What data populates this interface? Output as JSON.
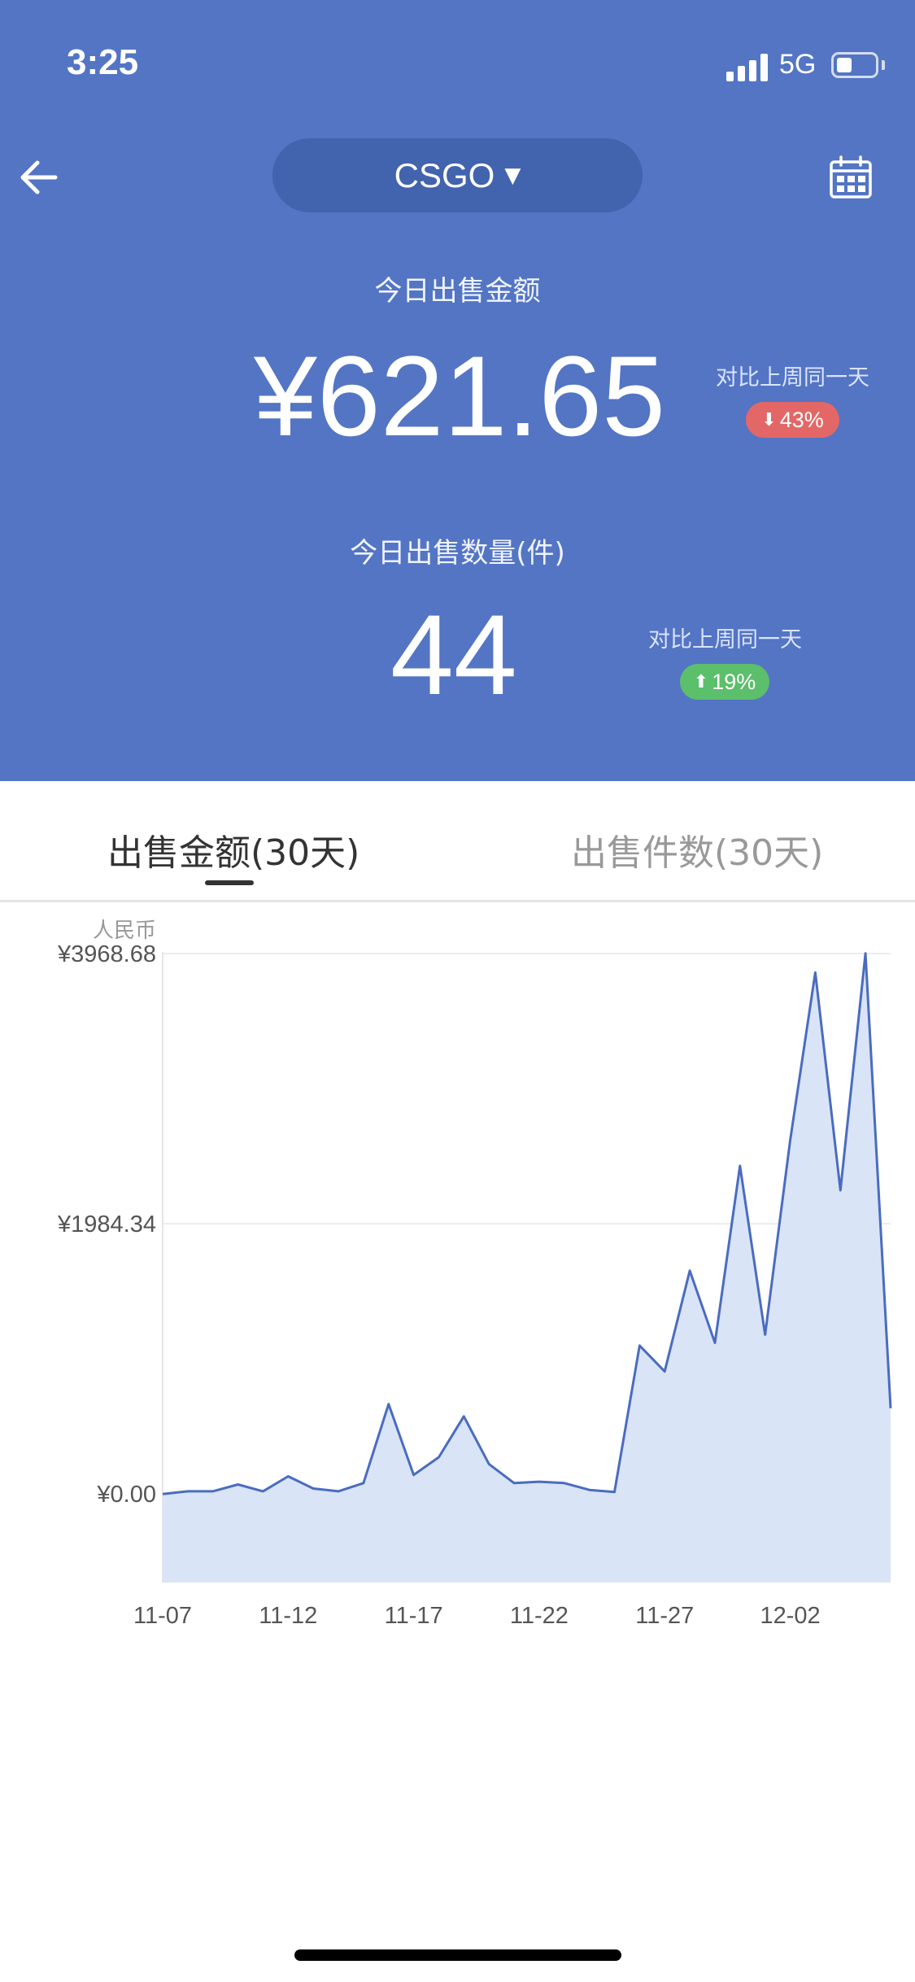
{
  "status_bar": {
    "time": "3:25",
    "network": "5G",
    "battery_level": 0.35
  },
  "nav": {
    "back_icon": "arrow-left-icon",
    "game_selector": "CSGO",
    "game_selector_icon": "caret-down-icon",
    "calendar_icon": "calendar-icon"
  },
  "summary": {
    "amount_label": "今日出售金额",
    "amount_value": "¥621.65",
    "amount_compare_label": "对比上周同一天",
    "amount_change": "43%",
    "amount_change_direction": "down",
    "count_label": "今日出售数量(件)",
    "count_value": "44",
    "count_compare_label": "对比上周同一天",
    "count_change": "19%",
    "count_change_direction": "up"
  },
  "tabs": [
    {
      "label": "出售金额(30天)",
      "active": true
    },
    {
      "label": "出售件数(30天)",
      "active": false
    }
  ],
  "colors": {
    "header_bg": "#5375c4",
    "selector_bg": "#4263ad",
    "line": "#4a6cc0",
    "area_fill": "#dae4f7",
    "badge_down": "#e36767",
    "badge_up": "#5cbf6b"
  },
  "chart_data": {
    "type": "area",
    "ylabel": "人民币",
    "yticks": [
      "¥3968.68",
      "¥1984.34",
      "¥0.00"
    ],
    "ytick_values": [
      3968.68,
      1984.34,
      0
    ],
    "ylim": [
      -650,
      4100
    ],
    "xticks": [
      "11-07",
      "11-12",
      "11-17",
      "11-22",
      "11-27",
      "12-02"
    ],
    "grid": true,
    "series": [
      {
        "values": [
          0,
          20,
          20,
          70,
          20,
          130,
          40,
          20,
          80,
          660,
          140,
          270,
          570,
          220,
          80,
          90,
          80,
          30,
          15,
          1090,
          900,
          1640,
          1110,
          2410,
          1170,
          2600,
          3830,
          2230,
          3970,
          630
        ]
      }
    ]
  }
}
